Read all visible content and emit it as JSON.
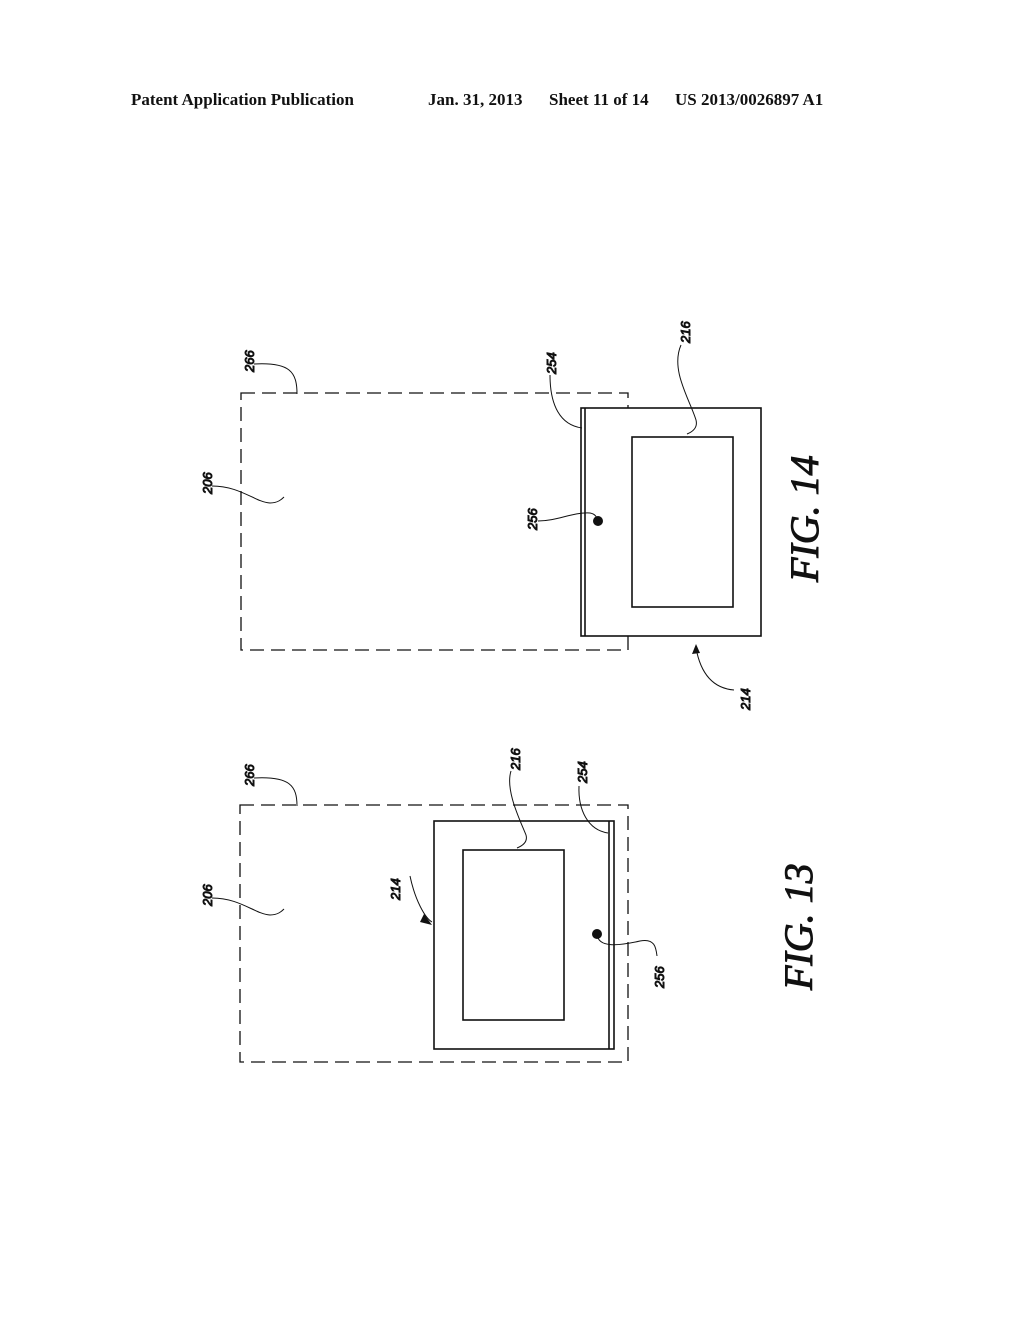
{
  "header": {
    "publication": "Patent Application Publication",
    "date": "Jan. 31, 2013",
    "sheet": "Sheet 11 of 14",
    "number": "US 2013/0026897 A1"
  },
  "figures": [
    {
      "id": "fig14",
      "caption": "FIG. 14",
      "labels": {
        "outer": "266",
        "region": "206",
        "edge": "254",
        "panel": "216",
        "dot": "256",
        "device": "214"
      }
    },
    {
      "id": "fig13",
      "caption": "FIG. 13",
      "labels": {
        "outer": "266",
        "region": "206",
        "edge": "254",
        "panel": "216",
        "dot": "256",
        "device": "214"
      }
    }
  ]
}
